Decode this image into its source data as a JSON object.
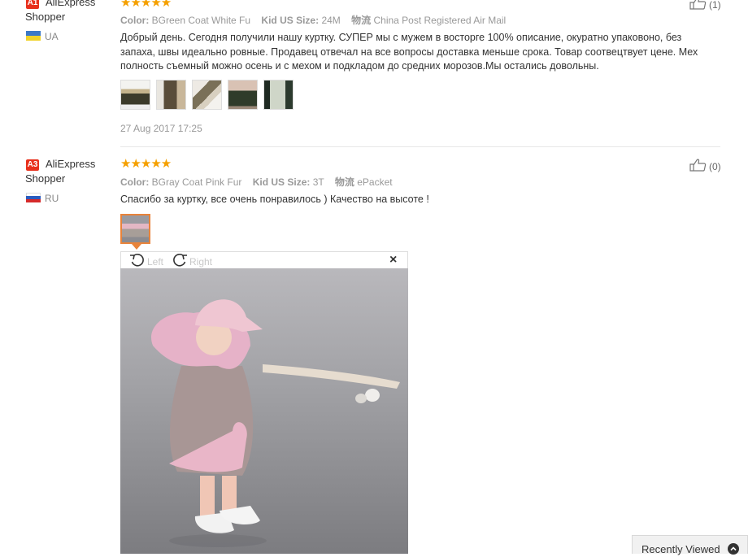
{
  "reviews": [
    {
      "badge": "A1",
      "user": "AliExpress Shopper",
      "country": "UA",
      "stars": "★★★★★",
      "color_label": "Color:",
      "color_value": "BGreen Coat White Fu",
      "size_label": "Kid US Size:",
      "size_value": "24M",
      "ship_label": "物流",
      "ship_value": "China Post Registered Air Mail",
      "text": "Добрый день. Сегодня получили нашу куртку. СУПЕР мы с мужем в восторге 100% описание, окуратно упаковоно, без запаха, швы идеально ровные. Продавец отвечал на все вопросы доставка меньше срока. Товар соотвецтвует цене. Мех полность съемный можно осень и с мехом и подкладом до средних морозов.Мы остались довольны.",
      "date": "27 Aug 2017 17:25",
      "likes": "(1)"
    },
    {
      "badge": "A3",
      "user": "AliExpress Shopper",
      "country": "RU",
      "stars": "★★★★★",
      "color_label": "Color:",
      "color_value": "BGray Coat Pink Fur",
      "size_label": "Kid US Size:",
      "size_value": "3T",
      "ship_label": "物流",
      "ship_value": "ePacket",
      "text": "Спасибо за куртку, все очень понравилось ) Качество на высоте !",
      "likes": "(0)"
    }
  ],
  "viewer": {
    "rotate_left": "Left",
    "rotate_right": "Right",
    "close": "×"
  },
  "recently_viewed": "Recently Viewed",
  "colors": {
    "accent": "#e8301c",
    "star": "#f5a000",
    "selected_thumb_border": "#e8833a"
  },
  "icons": [
    "thumbs-up-icon",
    "rotate-left-icon",
    "rotate-right-icon",
    "close-icon",
    "chevron-up-icon"
  ]
}
